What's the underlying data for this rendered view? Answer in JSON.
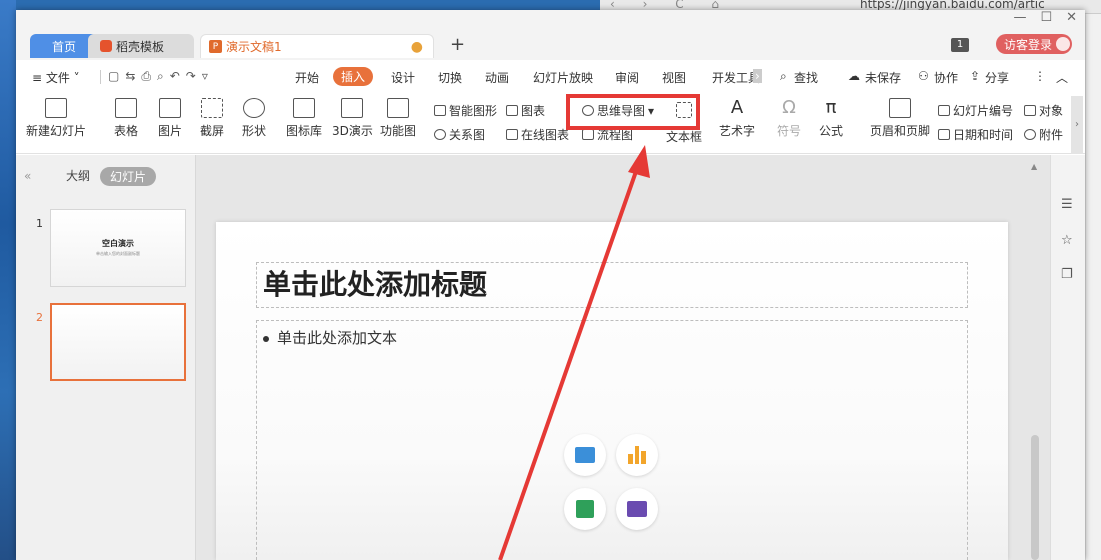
{
  "browser": {
    "url": "https://jingyan.baidu.com/artic",
    "nav": "‹ › C ⌂"
  },
  "tabs": {
    "home": "首页",
    "template": "稻壳模板",
    "document": "演示文稿1",
    "document_icon_letter": "P",
    "add": "+"
  },
  "titlebar": {
    "badge": "1",
    "login": "访客登录"
  },
  "window_controls": {
    "minimize": "—",
    "maximize": "☐",
    "close": "✕"
  },
  "menubar": {
    "file": "≡ 文件 ˅",
    "items": [
      "开始",
      "插入",
      "设计",
      "切换",
      "动画",
      "幻灯片放映",
      "审阅",
      "视图",
      "开发工具"
    ],
    "active": "插入",
    "search": "查找",
    "unsaved": "未保存",
    "collab": "协作",
    "share": "分享"
  },
  "ribbon": {
    "new_slide": "新建幻灯片",
    "table": "表格",
    "picture": "图片",
    "screenshot": "截屏",
    "shape": "形状",
    "icon_library": "图标库",
    "demo3d": "3D演示",
    "function_chart": "功能图",
    "smart_shape": "智能图形",
    "chart": "图表",
    "mindmap": "思维导图",
    "relation": "关系图",
    "online_chart": "在线图表",
    "flowchart": "流程图",
    "textbox": "文本框",
    "art_text": "艺术字",
    "symbol": "符号",
    "formula": "公式",
    "header_footer": "页眉和页脚",
    "slide_number": "幻灯片编号",
    "object": "对象",
    "datetime": "日期和时间",
    "attachment": "附件"
  },
  "leftpanel": {
    "collapse": "«",
    "outline_tab": "大纲",
    "slides_tab": "幻灯片",
    "thumbnails": [
      {
        "number": "1",
        "title": "空白演示",
        "subtitle": "单击输入您的封面副标题"
      },
      {
        "number": "2",
        "title": "",
        "subtitle": ""
      }
    ]
  },
  "slide": {
    "title_placeholder": "单击此处添加标题",
    "body_placeholder": "单击此处添加文本"
  },
  "colors": {
    "accent": "#e8713b",
    "highlight": "#e53935",
    "tab_home": "#4f8fe6"
  }
}
